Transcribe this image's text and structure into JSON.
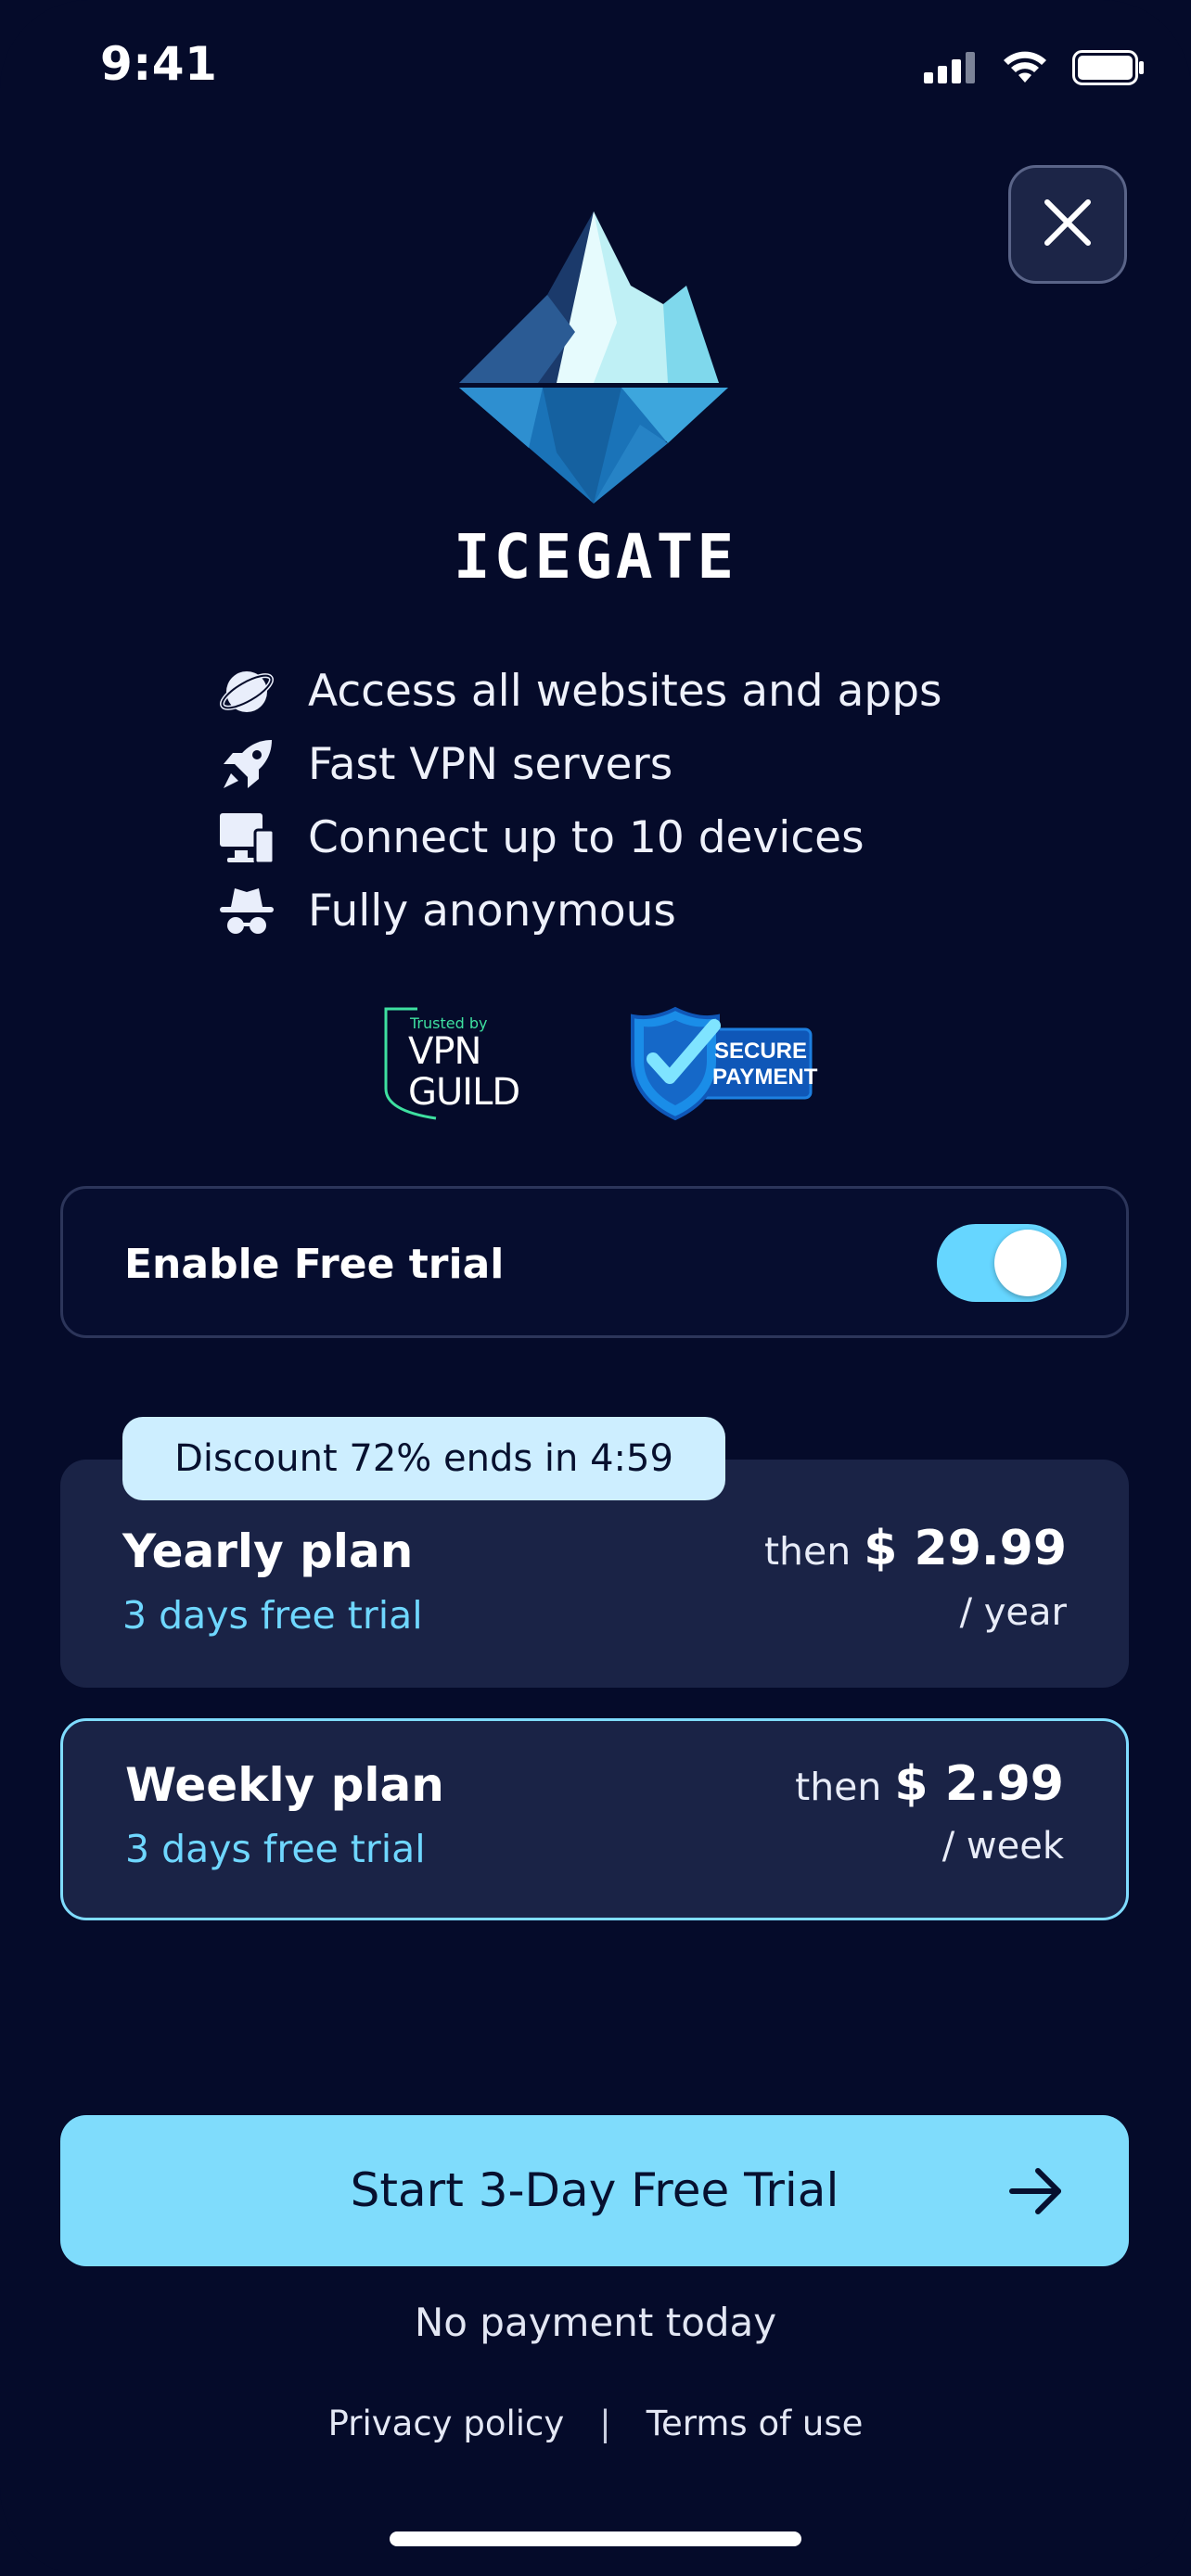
{
  "status_bar": {
    "time": "9:41",
    "icons": [
      "cellular-signal-icon",
      "wifi-icon",
      "battery-icon"
    ]
  },
  "close_button": {
    "icon": "close-icon"
  },
  "brand": {
    "name": "ICEGATE",
    "logo_icon": "iceberg-logo-icon"
  },
  "features": [
    {
      "icon": "planet-icon",
      "text": "Access all websites and apps"
    },
    {
      "icon": "rocket-icon",
      "text": "Fast VPN servers"
    },
    {
      "icon": "devices-icon",
      "text": "Connect up to 10 devices"
    },
    {
      "icon": "incognito-icon",
      "text": "Fully anonymous"
    }
  ],
  "badges": {
    "vpn_guild_small": "Trusted by",
    "vpn_guild_line1": "VPN",
    "vpn_guild_line2": "GUILD",
    "secure_line1": "SECURE",
    "secure_line2": "PAYMENT"
  },
  "trial_toggle": {
    "label": "Enable Free trial",
    "enabled": true
  },
  "discount_badge": "Discount 72% ends in 4:59",
  "plans": {
    "yearly": {
      "name": "Yearly plan",
      "trial": "3 days free trial",
      "then": "then",
      "price": "$ 29.99",
      "period": "/ year"
    },
    "weekly": {
      "name": "Weekly plan",
      "trial": "3 days free trial",
      "then": "then",
      "price": "$ 2.99",
      "period": "/ week"
    }
  },
  "cta": {
    "label": "Start 3-Day Free Trial",
    "icon": "arrow-right-icon"
  },
  "no_payment": "No payment today",
  "footer": {
    "privacy": "Privacy policy",
    "separator": "|",
    "terms": "Terms of use"
  },
  "colors": {
    "background": "#050b2a",
    "card": "#1a2346",
    "accent": "#7fdcfc",
    "accent_text": "#6fd7ff",
    "discount_bg": "#cdeeff"
  }
}
